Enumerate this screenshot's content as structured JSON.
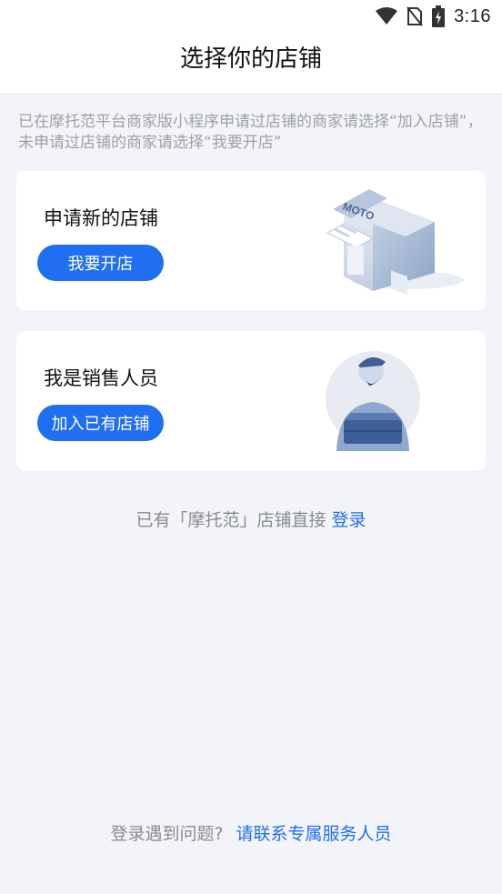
{
  "status_bar": {
    "time": "3:16",
    "icons": [
      "wifi-icon",
      "no-sim-icon",
      "battery-charging-icon"
    ]
  },
  "header": {
    "title": "选择你的店铺"
  },
  "hint": "已在摩托范平台商家版小程序申请过店铺的商家请选择“加入店铺”，未申请过店铺的商家请选择“我要开店”",
  "cards": [
    {
      "title": "申请新的店铺",
      "button_label": "我要开店",
      "illustration": "storefront-moto-illustration",
      "sign_text": "MOTO"
    },
    {
      "title": "我是销售人员",
      "button_label": "加入已有店铺",
      "illustration": "salesperson-with-box-illustration"
    }
  ],
  "login": {
    "prefix": "已有「摩托范」店铺直接",
    "link": "登录"
  },
  "help": {
    "prefix": "登录遇到问题?",
    "link": "请联系专属服务人员"
  },
  "colors": {
    "accent": "#1f6ff0",
    "background": "#f3f4f8",
    "muted_text": "#9da0a8"
  }
}
